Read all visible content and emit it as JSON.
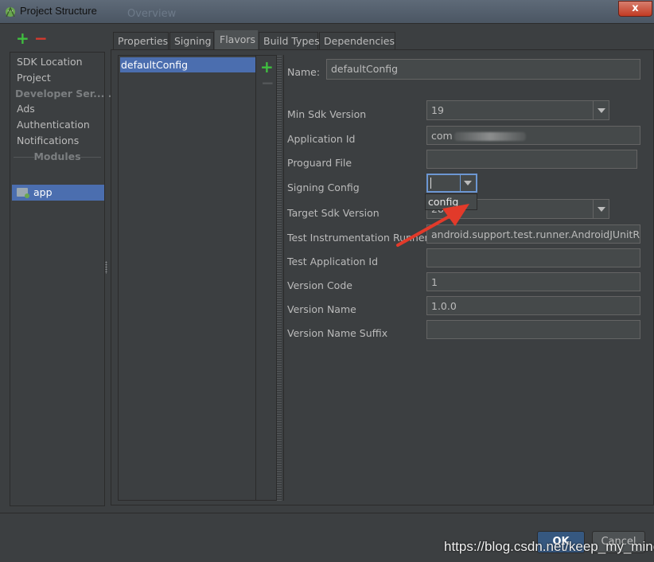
{
  "window": {
    "title": "Project Structure",
    "background_title": "Overview",
    "close_label": "x"
  },
  "colors": {
    "accent": "#4b6eaf",
    "add": "#3fbf3f",
    "remove": "#d63a2e",
    "annotation_arrow": "#e23a2a"
  },
  "sidebar": {
    "add_icon": "+",
    "remove_icon": "−",
    "items": [
      {
        "label": "SDK Location"
      },
      {
        "label": "Project"
      }
    ],
    "developer_header": "Developer Ser... ...",
    "developer_items": [
      {
        "label": "Ads"
      },
      {
        "label": "Authentication"
      },
      {
        "label": "Notifications"
      }
    ],
    "modules_header": "Modules",
    "modules": [
      {
        "label": "app",
        "icon": "module-folder-icon"
      }
    ]
  },
  "tabs": [
    {
      "label": "Properties"
    },
    {
      "label": "Signing"
    },
    {
      "label": "Flavors",
      "active": true
    },
    {
      "label": "Build Types"
    },
    {
      "label": "Dependencies"
    }
  ],
  "flavors": {
    "items": [
      "defaultConfig"
    ],
    "add_icon": "+",
    "remove_icon": "−"
  },
  "form": {
    "name": {
      "label": "Name:",
      "value": "defaultConfig"
    },
    "min_sdk": {
      "label": "Min Sdk Version",
      "value": "19"
    },
    "application_id": {
      "label": "Application Id",
      "value": "com"
    },
    "proguard": {
      "label": "Proguard File",
      "value": ""
    },
    "signing": {
      "label": "Signing Config",
      "value": "",
      "popup_option": "config"
    },
    "target_sdk": {
      "label": "Target Sdk Version",
      "value": "28"
    },
    "test_runner": {
      "label": "Test Instrumentation Runner",
      "value": "android.support.test.runner.AndroidJUnitRunner"
    },
    "test_app_id": {
      "label": "Test Application Id",
      "value": ""
    },
    "version_code": {
      "label": "Version Code",
      "value": "1"
    },
    "version_name": {
      "label": "Version Name",
      "value": "1.0.0"
    },
    "version_suffix": {
      "label": "Version Name Suffix",
      "value": ""
    }
  },
  "buttons": {
    "ok": "OK",
    "cancel": "Cancel"
  },
  "watermark": "https://blog.csdn.net/keep_my_mine"
}
